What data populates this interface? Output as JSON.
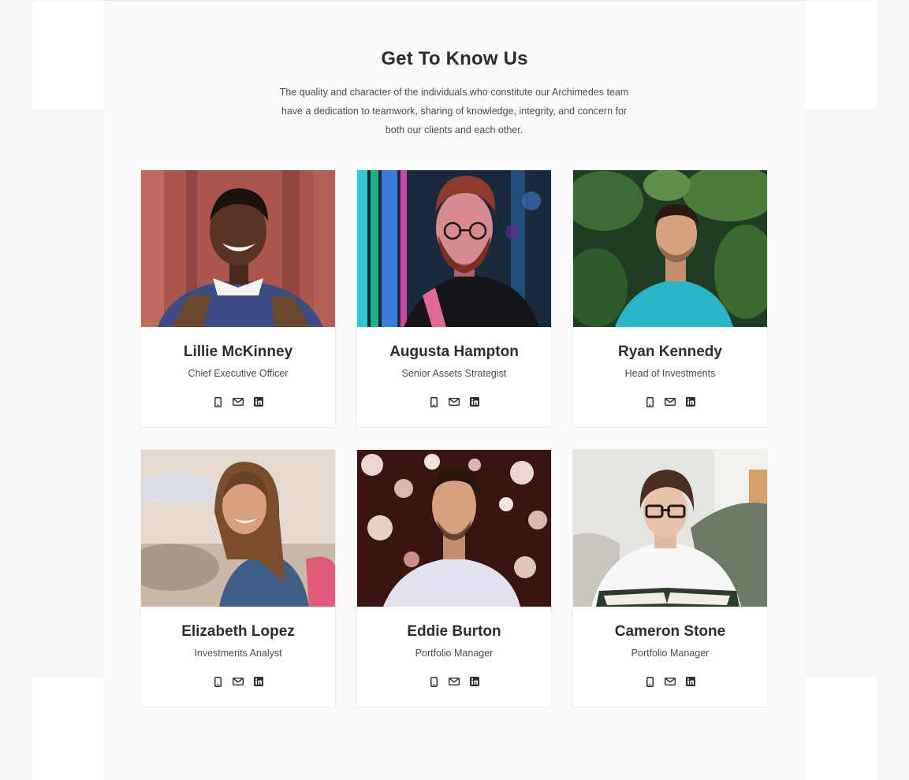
{
  "section": {
    "title": "Get To Know Us",
    "intro_lines": [
      "The quality and character of the individuals who constitute our Archimedes team",
      "have a dedication to teamwork, sharing of knowledge, integrity, and concern for",
      "both our clients and each other."
    ]
  },
  "icons": {
    "phone": "mobile-phone-icon",
    "email": "envelope-icon",
    "linkedin": "linkedin-icon"
  },
  "team": [
    {
      "name": "Lillie McKinney",
      "role": "Chief Executive Officer"
    },
    {
      "name": "Augusta Hampton",
      "role": "Senior Assets Strategist"
    },
    {
      "name": "Ryan Kennedy",
      "role": "Head of Investments"
    },
    {
      "name": "Elizabeth Lopez",
      "role": "Investments Analyst"
    },
    {
      "name": "Eddie Burton",
      "role": "Portfolio Manager"
    },
    {
      "name": "Cameron Stone",
      "role": "Portfolio Manager"
    }
  ],
  "colors": {
    "text": "#2b2d33",
    "muted": "#4a4c52",
    "page_bg": "#f7f7f7",
    "card_bg": "#ffffff"
  }
}
